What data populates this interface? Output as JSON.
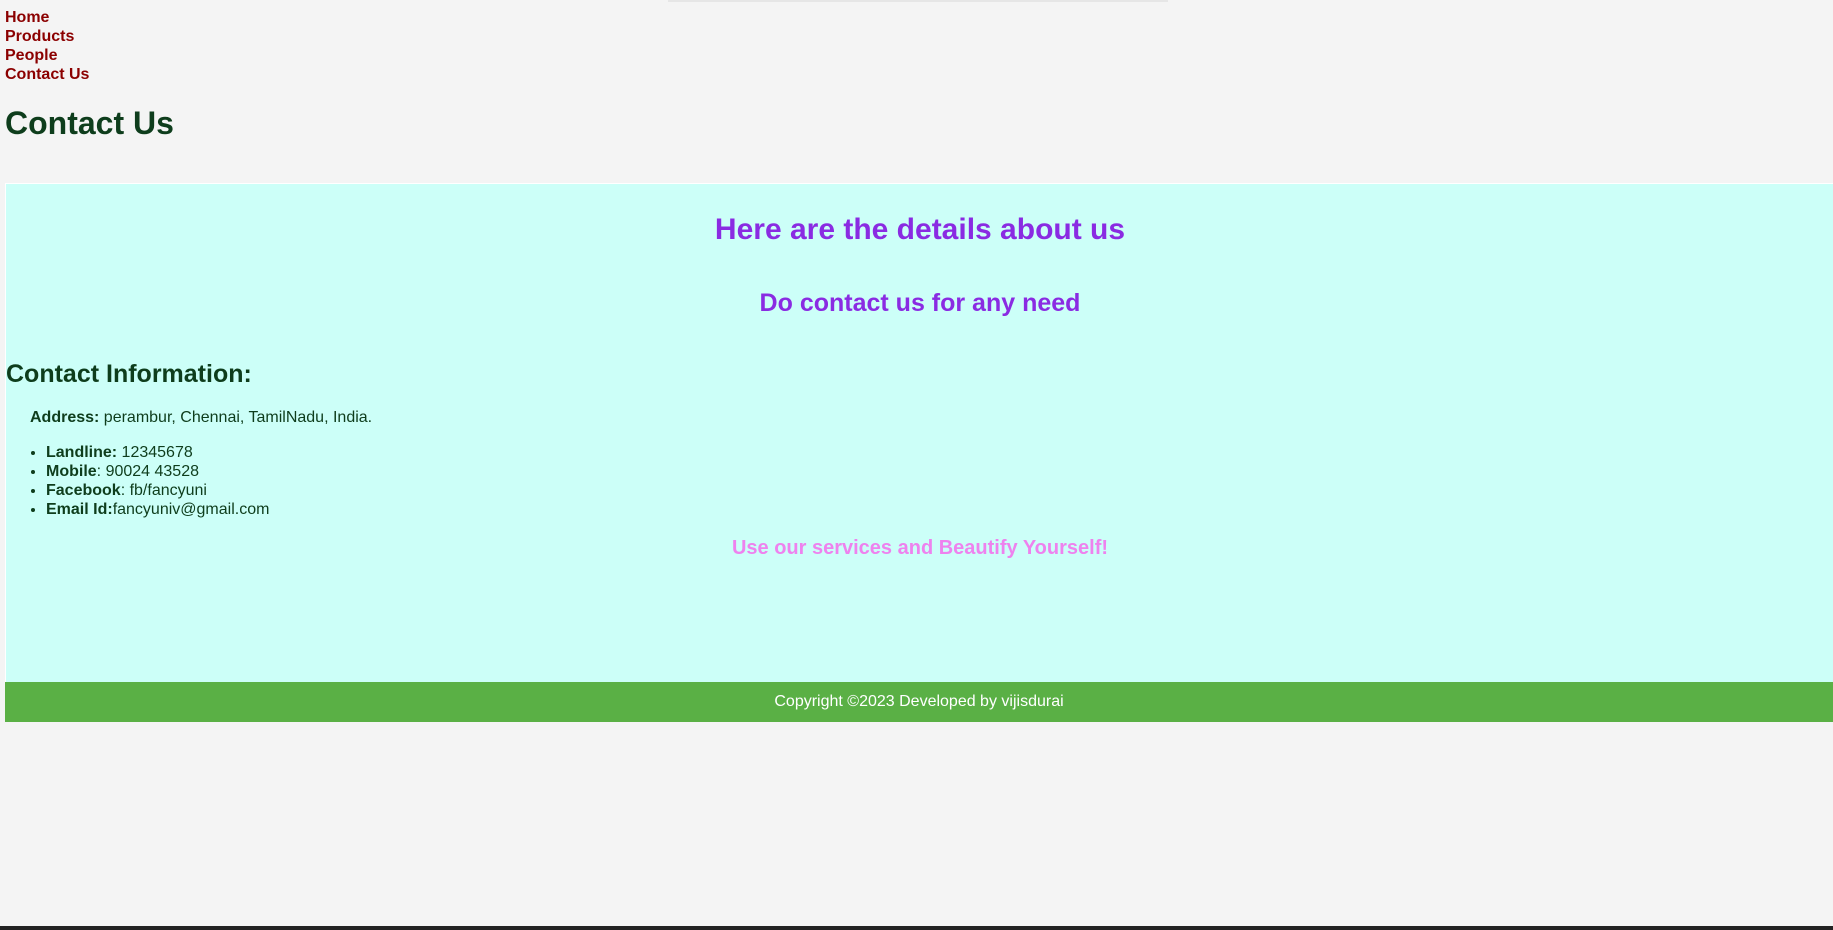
{
  "nav": {
    "items": [
      {
        "label": "Home"
      },
      {
        "label": "Products"
      },
      {
        "label": "People"
      },
      {
        "label": "Contact Us"
      }
    ]
  },
  "page": {
    "title": "Contact Us"
  },
  "content": {
    "heading": "Here are the details about us",
    "subheading": "Do contact us for any need",
    "info_heading": "Contact Information:",
    "address": {
      "label": "Address:",
      "value": " perambur, Chennai, TamilNadu, India."
    },
    "contacts": [
      {
        "label": "Landline:",
        "value": " 12345678"
      },
      {
        "label": "Mobile",
        "value": ": 90024 43528"
      },
      {
        "label": "Facebook",
        "value": ": fb/fancyuni"
      },
      {
        "label": "Email Id:",
        "value": "fancyuniv@gmail.com"
      }
    ],
    "tagline": "Use our services and Beautify Yourself!"
  },
  "footer": {
    "text": "Copyright ©2023 Developed by vijisdurai"
  },
  "colors": {
    "page_background": "#f4f4f4",
    "nav_link": "#8b0000",
    "text_dark_green": "#0e3d1c",
    "panel_background": "#ccfff8",
    "heading_purple": "#8a2be2",
    "tagline_violet": "#ee82ee",
    "footer_green": "#5ab045"
  }
}
